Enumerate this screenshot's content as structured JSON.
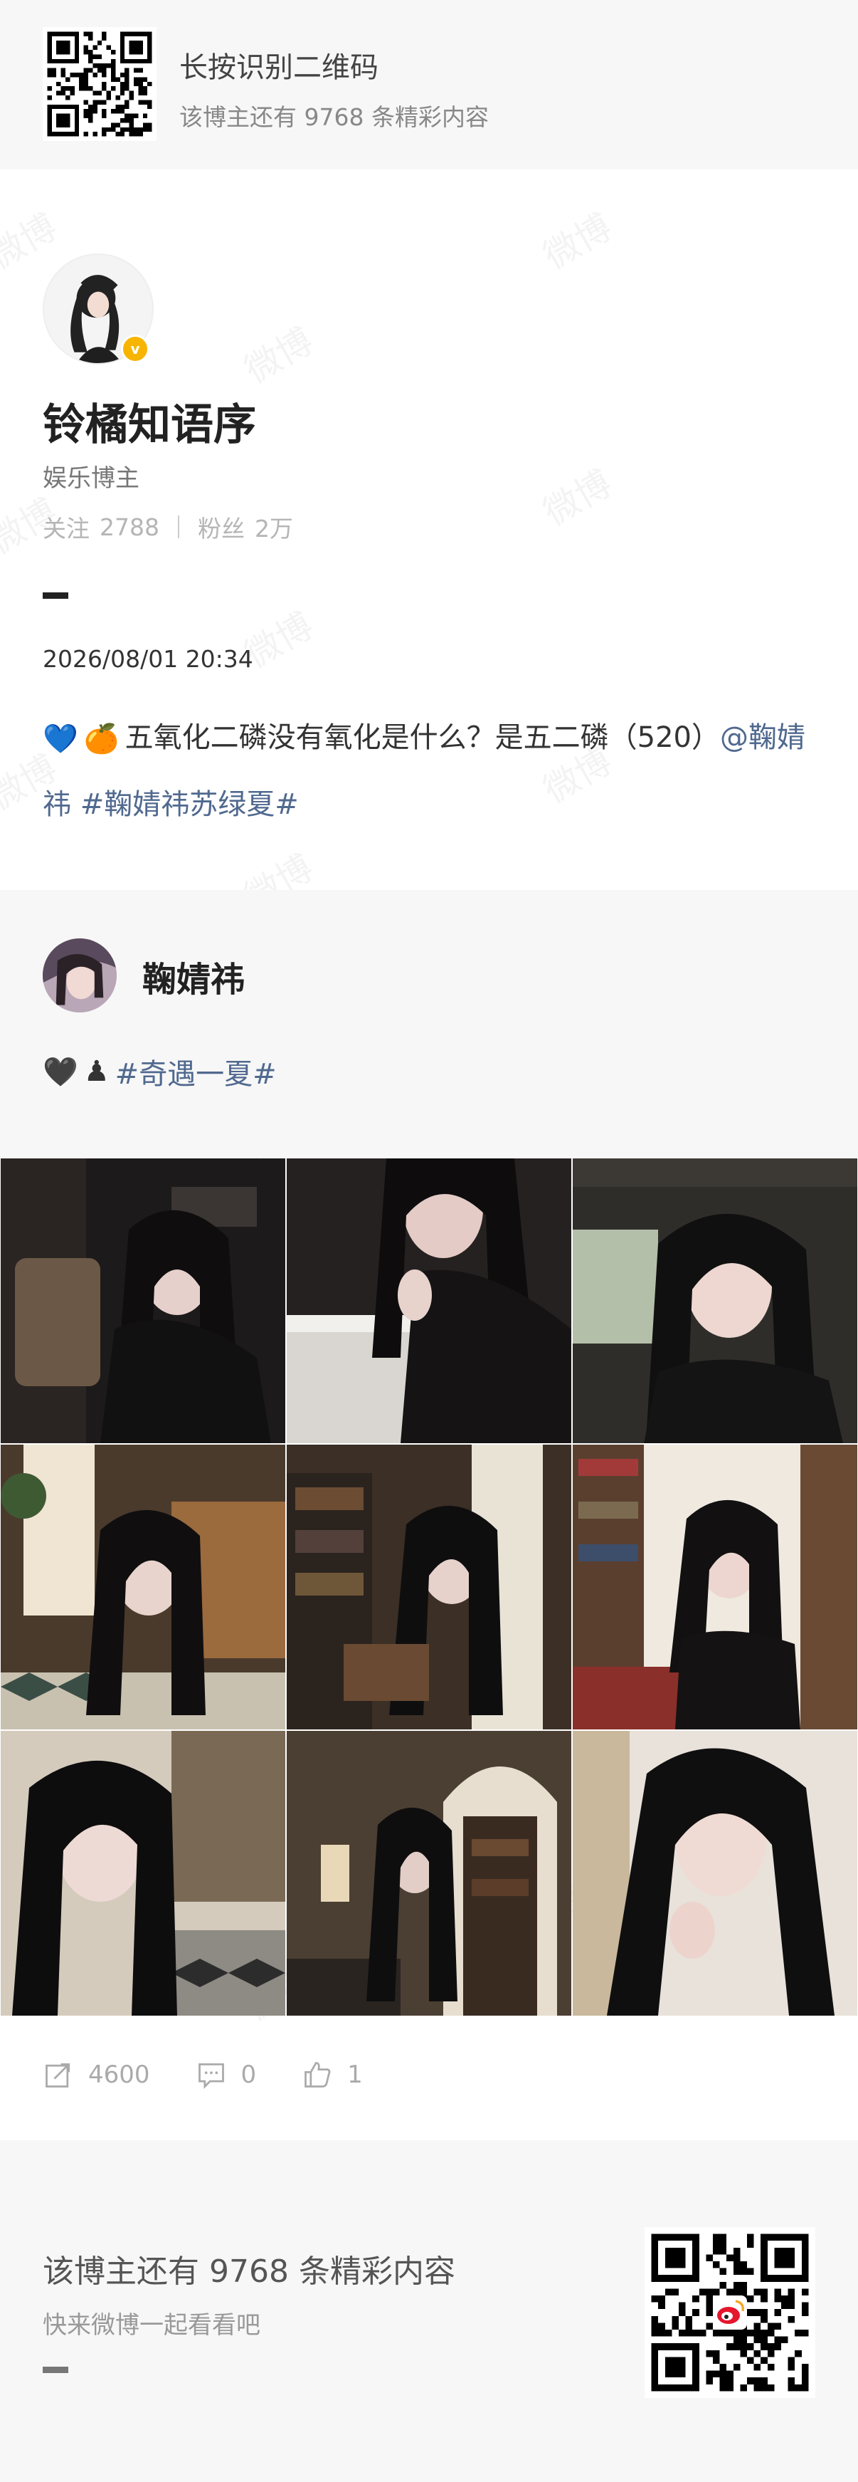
{
  "top_banner": {
    "title": "长按识别二维码",
    "subtitle": "该博主还有 9768 条精彩内容"
  },
  "profile": {
    "name": "铃橘知语序",
    "role": "娱乐博主",
    "following_label": "关注",
    "following_count": "2788",
    "followers_label": "粉丝",
    "followers_count": "2万",
    "verified_badge": "v"
  },
  "post": {
    "time": "2026/08/01 20:34",
    "emoji_1": "💙",
    "emoji_2": "🍊",
    "text": "五氧化二磷没有氧化是什么？是五二磷（520）",
    "mention": "@鞠婧祎",
    "hashtag": "#鞠婧祎苏绿夏#"
  },
  "repost": {
    "author": "鞠婧祎",
    "emoji_1": "🖤",
    "emoji_2": "♟",
    "hashtag": "#奇遇一夏#",
    "photos": [
      "photo-1",
      "photo-2",
      "photo-3",
      "photo-4",
      "photo-5",
      "photo-6",
      "photo-7",
      "photo-8",
      "photo-9"
    ]
  },
  "actions": {
    "repost_count": "4600",
    "comment_count": "0",
    "like_count": "1"
  },
  "bottom_banner": {
    "title": "该博主还有 9768 条精彩内容",
    "subtitle": "快来微博一起看看吧"
  },
  "watermark": "微博",
  "colors": {
    "link": "#50698f",
    "banner_bg": "#f7f7f7",
    "verify": "#f7b500"
  }
}
